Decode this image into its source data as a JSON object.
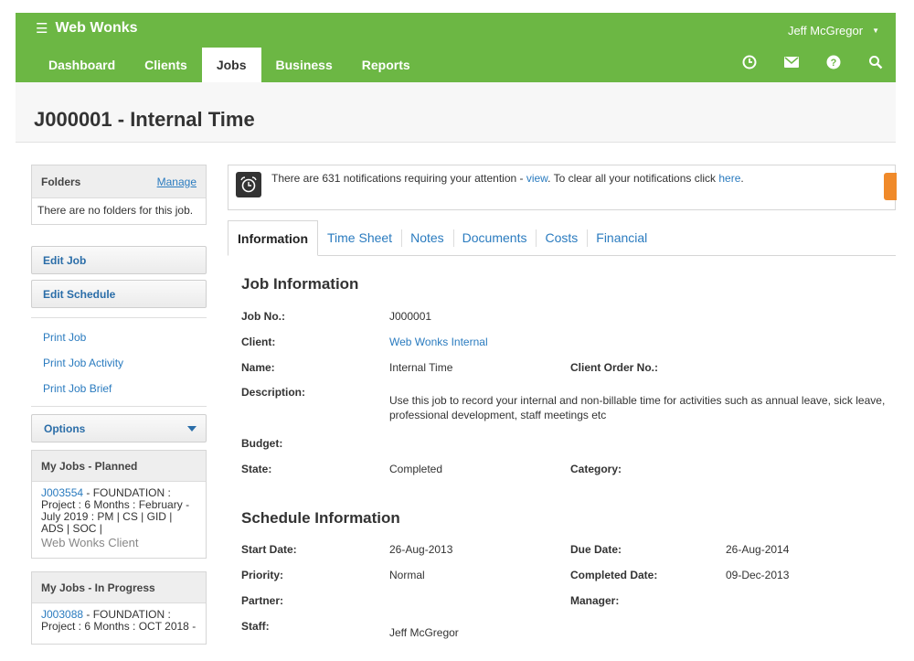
{
  "app": {
    "brand": "Web Wonks",
    "user": "Jeff McGregor"
  },
  "nav": {
    "tabs": [
      "Dashboard",
      "Clients",
      "Jobs",
      "Business",
      "Reports"
    ],
    "active": "Jobs"
  },
  "page": {
    "title": "J000001 - Internal Time"
  },
  "sidebar": {
    "folders_title": "Folders",
    "folders_manage": "Manage",
    "folders_empty": "There are no folders for this job.",
    "edit_job": "Edit Job",
    "edit_schedule": "Edit Schedule",
    "print_job": "Print Job",
    "print_activity": "Print Job Activity",
    "print_brief": "Print Job Brief",
    "options": "Options",
    "planned_title": "My Jobs - Planned",
    "planned_job": {
      "code": "J003554",
      "desc": " - FOUNDATION : Project : 6 Months : February - July 2019 : PM | CS | GID | ADS | SOC |",
      "client": "Web Wonks Client"
    },
    "inprogress_title": "My Jobs - In Progress",
    "inprogress_job": {
      "code": "J003088",
      "desc": " - FOUNDATION : Project : 6 Months : OCT 2018 -"
    }
  },
  "notification": {
    "prefix": "There are 631 notifications requiring your attention - ",
    "view_link": "view",
    "middle": ". To clear all your notifications click ",
    "here_link": "here",
    "suffix": "."
  },
  "tabs": [
    "Information",
    "Time Sheet",
    "Notes",
    "Documents",
    "Costs",
    "Financial"
  ],
  "job_info": {
    "title": "Job Information",
    "job_no_label": "Job No.:",
    "job_no": "J000001",
    "client_label": "Client:",
    "client": "Web Wonks Internal",
    "name_label": "Name:",
    "name": "Internal Time",
    "client_order_label": "Client Order No.:",
    "description_label": "Description:",
    "description": "Use this job to record your internal and non-billable time for activities such as annual leave, sick leave, professional development, staff meetings etc",
    "budget_label": "Budget:",
    "state_label": "State:",
    "state": "Completed",
    "category_label": "Category:"
  },
  "schedule": {
    "title": "Schedule Information",
    "start_label": "Start Date:",
    "start": "26-Aug-2013",
    "due_label": "Due Date:",
    "due": "26-Aug-2014",
    "priority_label": "Priority:",
    "priority": "Normal",
    "completed_label": "Completed Date:",
    "completed": "09-Dec-2013",
    "partner_label": "Partner:",
    "manager_label": "Manager:",
    "staff_label": "Staff:",
    "staff": "Jeff McGregor"
  },
  "colors": {
    "brand_green": "#6cb744",
    "link_blue": "#2a7bbf",
    "badge_orange": "#f08a2a"
  }
}
